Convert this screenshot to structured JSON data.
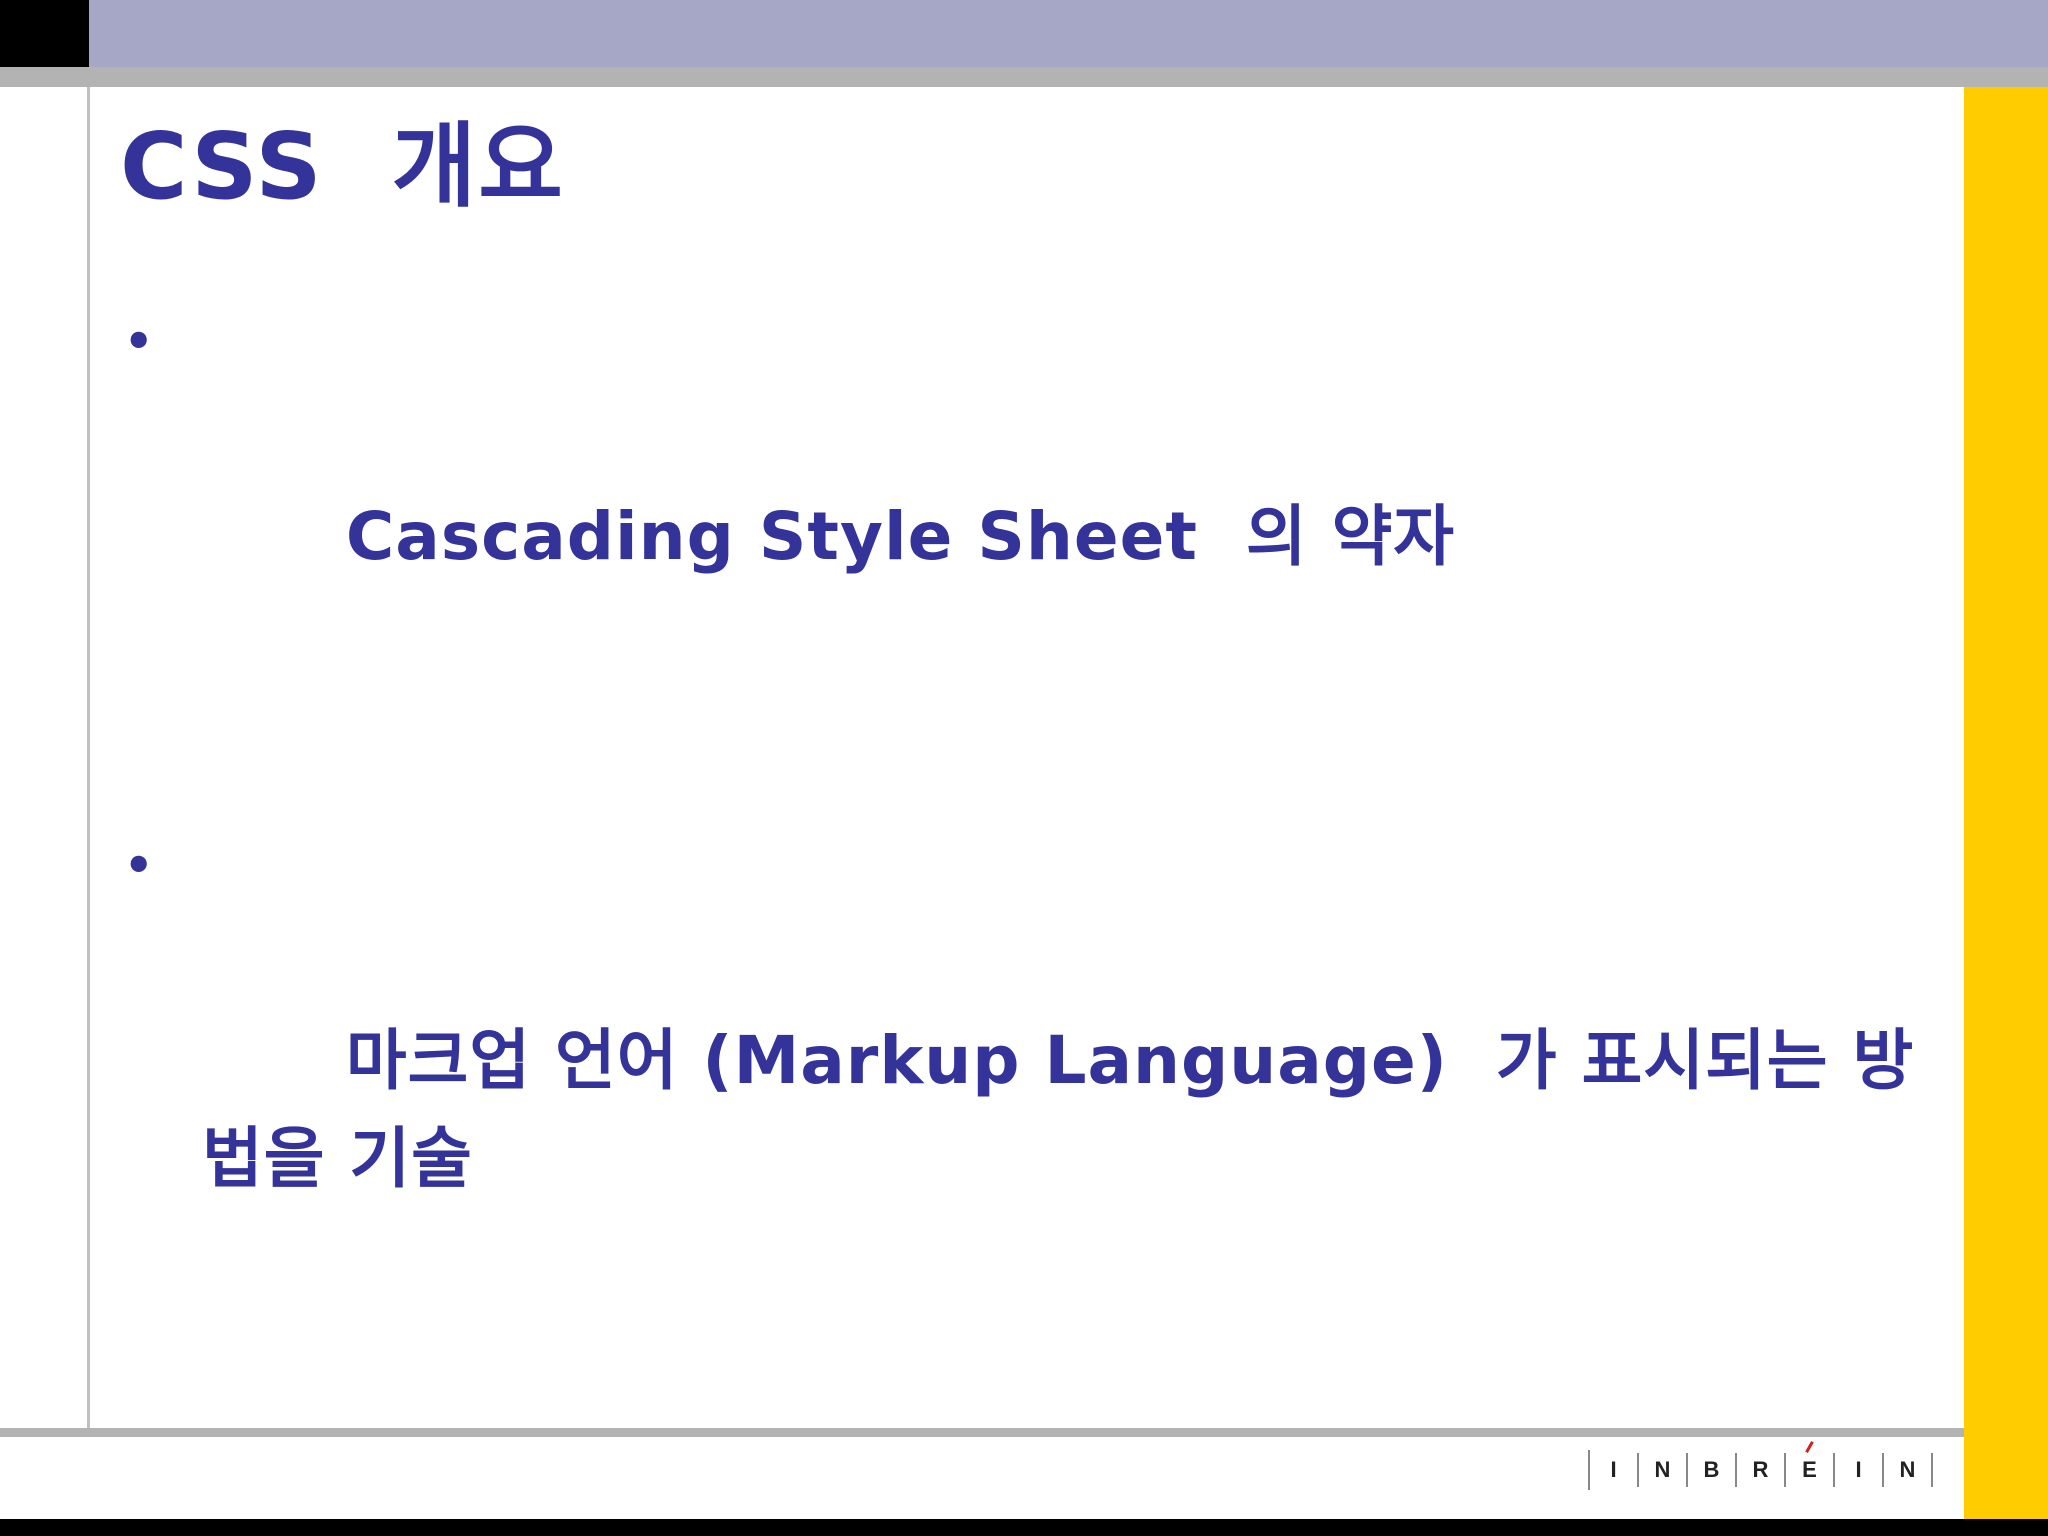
{
  "slide": {
    "title": "CSS  개요",
    "bullets": [
      "Cascading Style Sheet  의 약자",
      "마크업 언어 (Markup Language)  가 표시되는 방법을 기술"
    ],
    "bullet_symbol": "•"
  },
  "logo": {
    "letters": [
      "I",
      "N",
      "B",
      "R",
      "E",
      "I",
      "N"
    ],
    "accent_letter_index": 4,
    "accent_color": "#cc2222"
  },
  "colors": {
    "text": "#333399",
    "top_band": "#a6a6c6",
    "right_bar": "#ffcc00",
    "rules": "#b3b3b3"
  }
}
